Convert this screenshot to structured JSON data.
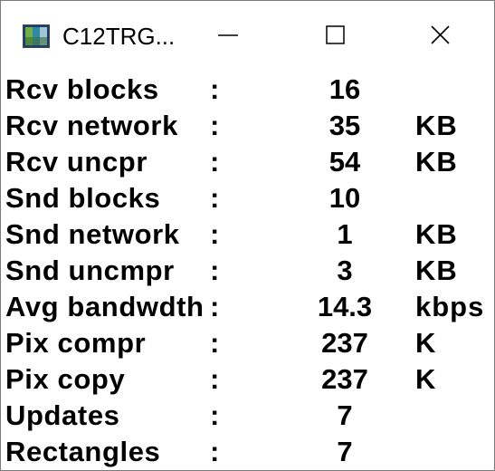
{
  "window": {
    "title": "C12TRG...",
    "icon": "app-icon"
  },
  "stats": [
    {
      "label": "Rcv blocks",
      "colon": ":",
      "value": "16",
      "unit": ""
    },
    {
      "label": "Rcv network",
      "colon": ":",
      "value": "35",
      "unit": "KB"
    },
    {
      "label": "Rcv uncpr",
      "colon": ":",
      "value": "54",
      "unit": "KB"
    },
    {
      "label": "Snd blocks",
      "colon": ":",
      "value": "10",
      "unit": ""
    },
    {
      "label": "Snd network",
      "colon": ":",
      "value": "1",
      "unit": "KB"
    },
    {
      "label": "Snd uncmpr",
      "colon": ":",
      "value": "3",
      "unit": "KB"
    },
    {
      "label": "Avg bandwdth",
      "colon": ":",
      "value": "14.3",
      "unit": "kbps"
    },
    {
      "label": "Pix compr",
      "colon": ":",
      "value": "237",
      "unit": "K"
    },
    {
      "label": "Pix copy",
      "colon": ":",
      "value": "237",
      "unit": "K"
    },
    {
      "label": "Updates",
      "colon": ":",
      "value": "7",
      "unit": ""
    },
    {
      "label": "Rectangles",
      "colon": ":",
      "value": "7",
      "unit": ""
    }
  ],
  "colors": {
    "icon_dark": "#1f3f6a",
    "icon_green": "#6fae4a",
    "icon_teal": "#2f8aa0"
  }
}
